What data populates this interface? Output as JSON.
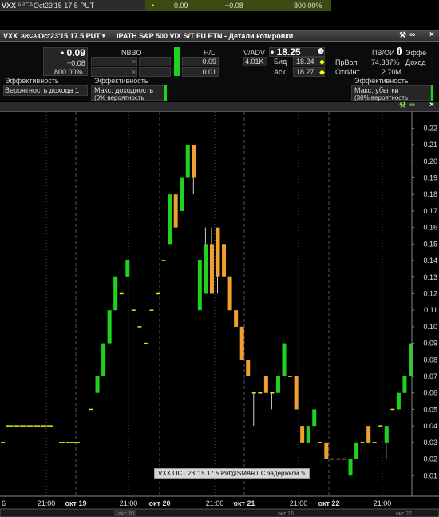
{
  "ticker": {
    "symbol": "VXX",
    "exchange": "ARCA",
    "contract": "Oct23'15 17.5 PUT",
    "marker": "•",
    "last": "0.09",
    "change": "+0.08",
    "change_pct": "800.00%"
  },
  "quote": {
    "title_symbol": "VXX",
    "title_exchange": "ARCA",
    "title_contract": "Oct23'15 17.5 PUT",
    "title_desc": "IPATH S&P 500 VIX S/T FU ETN - Детали котировки",
    "last": "• 0.09",
    "change": "+0.08",
    "change_pct": "800.00%",
    "nbbo_header": "NBBO",
    "hl_header": "H/L",
    "high": "0.09",
    "low": "0.01",
    "vadv_header": "V/ADV",
    "vadv_value": "4.01K",
    "underlying_price": "• 18.25",
    "bid_label": "Бид",
    "bid_value": "18.24",
    "ask_label": "Аск",
    "ask_value": "18.27",
    "pv_oi_header": "ПВ/ОИ",
    "effect_header_right": "Эффе",
    "pr_vol_label": "ПрВол",
    "pr_vol_value": "74.387%",
    "income_label": "Доход",
    "open_int_label": "ОткИнт",
    "open_int_value": "2.70M",
    "eff_label_1": "Эффективность",
    "eff_label_2": "Эффективность",
    "eff_label_3": "Эффективность",
    "prob_income": "Вероятность дохода 1",
    "max_profit": "Макс. доходность",
    "max_profit_sub": "(0% вероятность",
    "max_loss": "Макс. убытки",
    "max_loss_sub": "(30% вероятность"
  },
  "colors": {
    "up": "#1fd21f",
    "down": "#f0a030",
    "flat": "#e8e800",
    "grid": "#555555",
    "axis_text": "#e0e0e0"
  },
  "chart_data": {
    "type": "candlestick",
    "ylim": [
      0.0,
      0.225
    ],
    "y_ticks": [
      "0.22",
      "0.21",
      "0.20",
      "0.19",
      "0.18",
      "0.17",
      "0.16",
      "0.15",
      "0.14",
      "0.13",
      "0.12",
      "0.11",
      "0.10",
      "0.09",
      "0.08",
      "0.07",
      "0.06",
      "0.05",
      "0.04",
      "0.03",
      "0.02",
      "0.01"
    ],
    "x_tick_labels": [
      "6",
      "21:00",
      "окт 19",
      "21:00",
      "окт 20",
      "21:00",
      "окт 21",
      "21:00",
      "окт 22",
      "21:00"
    ],
    "bottom_strip_labels": [
      "окт 20",
      "окт 16",
      "окт 22"
    ],
    "tooltip": "VXX OCT 23 '15 17.5 Put@SMART С задержкой",
    "candles": [
      {
        "o": 0.03,
        "c": 0.03,
        "h": 0.03,
        "l": 0.03
      },
      {
        "o": 0.04,
        "c": 0.04,
        "h": 0.04,
        "l": 0.04
      },
      {
        "o": 0.04,
        "c": 0.04,
        "h": 0.04,
        "l": 0.04
      },
      {
        "o": 0.04,
        "c": 0.04,
        "h": 0.04,
        "l": 0.04
      },
      {
        "o": 0.04,
        "c": 0.04,
        "h": 0.04,
        "l": 0.04
      },
      {
        "o": 0.04,
        "c": 0.04,
        "h": 0.04,
        "l": 0.04
      },
      {
        "o": 0.04,
        "c": 0.04,
        "h": 0.04,
        "l": 0.04
      },
      {
        "o": 0.04,
        "c": 0.04,
        "h": 0.04,
        "l": 0.04
      },
      {
        "o": 0.03,
        "c": 0.03,
        "h": 0.03,
        "l": 0.03
      },
      {
        "o": 0.03,
        "c": 0.03,
        "h": 0.03,
        "l": 0.03
      },
      {
        "o": 0.03,
        "c": 0.03,
        "h": 0.03,
        "l": 0.03
      },
      {
        "o": 0.05,
        "c": 0.05,
        "h": 0.05,
        "l": 0.05
      },
      {
        "o": 0.06,
        "c": 0.07,
        "h": 0.07,
        "l": 0.06
      },
      {
        "o": 0.07,
        "c": 0.09,
        "h": 0.09,
        "l": 0.07
      },
      {
        "o": 0.09,
        "c": 0.11,
        "h": 0.11,
        "l": 0.09
      },
      {
        "o": 0.11,
        "c": 0.13,
        "h": 0.13,
        "l": 0.11
      },
      {
        "o": 0.12,
        "c": 0.12,
        "h": 0.12,
        "l": 0.12
      },
      {
        "o": 0.13,
        "c": 0.14,
        "h": 0.14,
        "l": 0.13
      },
      {
        "o": 0.11,
        "c": 0.11,
        "h": 0.11,
        "l": 0.11
      },
      {
        "o": 0.1,
        "c": 0.1,
        "h": 0.1,
        "l": 0.1
      },
      {
        "o": 0.09,
        "c": 0.09,
        "h": 0.09,
        "l": 0.09
      },
      {
        "o": 0.11,
        "c": 0.11,
        "h": 0.11,
        "l": 0.11
      },
      {
        "o": 0.12,
        "c": 0.12,
        "h": 0.12,
        "l": 0.12
      },
      {
        "o": 0.14,
        "c": 0.14,
        "h": 0.14,
        "l": 0.14
      },
      {
        "o": 0.15,
        "c": 0.18,
        "h": 0.18,
        "l": 0.15
      },
      {
        "o": 0.18,
        "c": 0.16,
        "h": 0.18,
        "l": 0.16
      },
      {
        "o": 0.17,
        "c": 0.19,
        "h": 0.19,
        "l": 0.17
      },
      {
        "o": 0.19,
        "c": 0.21,
        "h": 0.21,
        "l": 0.19
      },
      {
        "o": 0.21,
        "c": 0.19,
        "h": 0.21,
        "l": 0.18
      },
      {
        "o": 0.11,
        "c": 0.14,
        "h": 0.14,
        "l": 0.11
      },
      {
        "o": 0.12,
        "c": 0.15,
        "h": 0.16,
        "l": 0.12
      },
      {
        "o": 0.15,
        "c": 0.12,
        "h": 0.16,
        "l": 0.12
      },
      {
        "o": 0.16,
        "c": 0.13,
        "h": 0.16,
        "l": 0.12
      },
      {
        "o": 0.15,
        "c": 0.13,
        "h": 0.15,
        "l": 0.13
      },
      {
        "o": 0.13,
        "c": 0.11,
        "h": 0.13,
        "l": 0.11
      },
      {
        "o": 0.11,
        "c": 0.1,
        "h": 0.11,
        "l": 0.1
      },
      {
        "o": 0.1,
        "c": 0.08,
        "h": 0.1,
        "l": 0.08
      },
      {
        "o": 0.08,
        "c": 0.07,
        "h": 0.08,
        "l": 0.07
      },
      {
        "o": 0.06,
        "c": 0.06,
        "h": 0.06,
        "l": 0.04
      },
      {
        "o": 0.06,
        "c": 0.06,
        "h": 0.06,
        "l": 0.06
      },
      {
        "o": 0.07,
        "c": 0.06,
        "h": 0.07,
        "l": 0.06
      },
      {
        "o": 0.06,
        "c": 0.06,
        "h": 0.06,
        "l": 0.05
      },
      {
        "o": 0.06,
        "c": 0.07,
        "h": 0.07,
        "l": 0.06
      },
      {
        "o": 0.07,
        "c": 0.09,
        "h": 0.09,
        "l": 0.07
      },
      {
        "o": 0.07,
        "c": 0.07,
        "h": 0.07,
        "l": 0.07
      },
      {
        "o": 0.07,
        "c": 0.05,
        "h": 0.07,
        "l": 0.05
      },
      {
        "o": 0.04,
        "c": 0.03,
        "h": 0.04,
        "l": 0.03
      },
      {
        "o": 0.03,
        "c": 0.04,
        "h": 0.04,
        "l": 0.03
      },
      {
        "o": 0.04,
        "c": 0.05,
        "h": 0.05,
        "l": 0.04
      },
      {
        "o": 0.03,
        "c": 0.03,
        "h": 0.03,
        "l": 0.03
      },
      {
        "o": 0.03,
        "c": 0.02,
        "h": 0.03,
        "l": 0.02
      },
      {
        "o": 0.02,
        "c": 0.02,
        "h": 0.02,
        "l": 0.02
      },
      {
        "o": 0.02,
        "c": 0.02,
        "h": 0.02,
        "l": 0.02
      },
      {
        "o": 0.02,
        "c": 0.02,
        "h": 0.02,
        "l": 0.02
      },
      {
        "o": 0.01,
        "c": 0.02,
        "h": 0.02,
        "l": 0.01
      },
      {
        "o": 0.02,
        "c": 0.03,
        "h": 0.03,
        "l": 0.02
      },
      {
        "o": 0.03,
        "c": 0.03,
        "h": 0.03,
        "l": 0.03
      },
      {
        "o": 0.04,
        "c": 0.03,
        "h": 0.04,
        "l": 0.03
      },
      {
        "o": 0.03,
        "c": 0.03,
        "h": 0.03,
        "l": 0.03
      },
      {
        "o": 0.04,
        "c": 0.04,
        "h": 0.04,
        "l": 0.04
      },
      {
        "o": 0.03,
        "c": 0.04,
        "h": 0.04,
        "l": 0.02
      },
      {
        "o": 0.05,
        "c": 0.05,
        "h": 0.05,
        "l": 0.05
      },
      {
        "o": 0.05,
        "c": 0.06,
        "h": 0.06,
        "l": 0.05
      },
      {
        "o": 0.06,
        "c": 0.07,
        "h": 0.07,
        "l": 0.06
      },
      {
        "o": 0.07,
        "c": 0.09,
        "h": 0.09,
        "l": 0.07
      }
    ]
  }
}
